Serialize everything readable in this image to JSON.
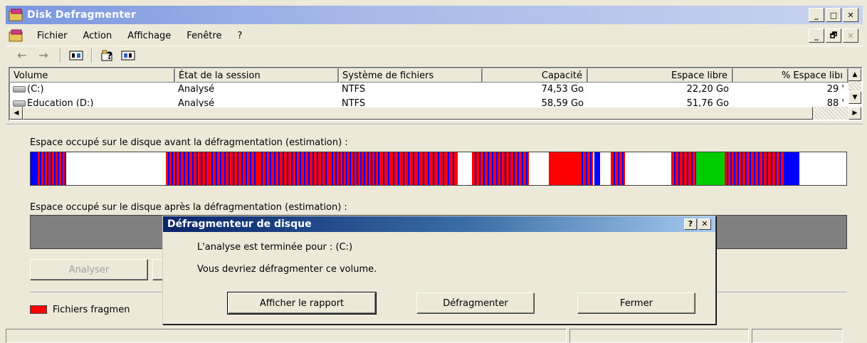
{
  "window": {
    "title": "Disk Defragmenter",
    "min": "_",
    "max": "□",
    "close": "✕"
  },
  "menu": [
    "Fichier",
    "Action",
    "Affichage",
    "Fenêtre",
    "?"
  ],
  "mdi": {
    "min": "_",
    "restore": "🗗",
    "close": "✕"
  },
  "toolbar": {
    "back": "←",
    "forward": "→"
  },
  "list": {
    "columns": [
      "Volume",
      "État de la session",
      "Système de fichiers",
      "Capacité",
      "Espace libre",
      "% Espace libı"
    ],
    "rows": [
      {
        "volume": "(C:)",
        "state": "Analysé",
        "fs": "NTFS",
        "capacity": "74,53 Go",
        "free": "22,20 Go",
        "pct": "29 '"
      },
      {
        "volume": "Education (D:)",
        "state": "Analysé",
        "fs": "NTFS",
        "capacity": "58,59 Go",
        "free": "51,76 Go",
        "pct": "88 '"
      }
    ]
  },
  "before_label": "Espace occupé sur le disque avant la défragmentation (estimation) :",
  "after_label": "Espace occupé sur le disque après la défragmentation (estimation) :",
  "colors": {
    "fragmented": "#ff0000",
    "contiguous": "#0000ff",
    "unmovable": "#00cc00",
    "free": "#ffffff"
  },
  "buttons": {
    "analyze": "Analyser"
  },
  "legend": {
    "fragmented": "Fichiers fragmen"
  },
  "dialog": {
    "title": "Défragmenteur de disque",
    "help": "?",
    "close": "✕",
    "line1": "L'analyse est terminée pour : (C:)",
    "line2": "Vous devriez défragmenter ce volume.",
    "report": "Afficher le rapport",
    "defrag": "Défragmenter",
    "close_btn": "Fermer"
  }
}
